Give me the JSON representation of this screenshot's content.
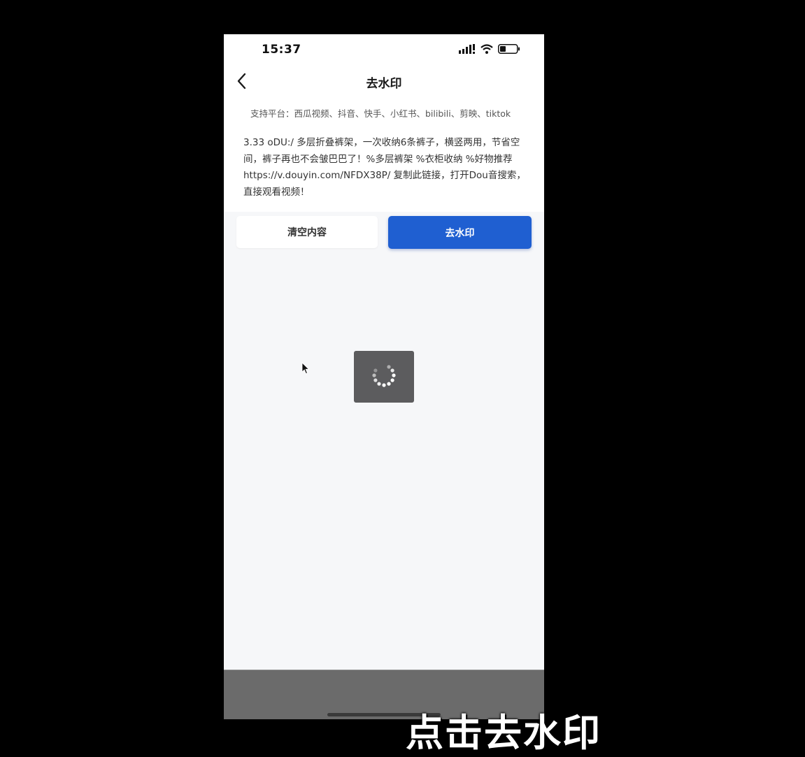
{
  "status_bar": {
    "time": "15:37"
  },
  "nav": {
    "title": "去水印"
  },
  "platforms_text": "支持平台：西瓜视频、抖音、快手、小红书、bilibili、剪映、tiktok",
  "input": {
    "value": "3.33 oDU:/ 多层折叠裤架，一次收纳6条裤子，横竖两用，节省空间，裤子再也不会皱巴巴了！%多层裤架 %衣柜收纳 %好物推荐  https://v.douyin.com/NFDX38P/ 复制此链接，打开Dou音搜索，直接观看视频！"
  },
  "buttons": {
    "clear_label": "清空内容",
    "remove_label": "去水印"
  },
  "caption": "点击去水印",
  "colors": {
    "primary": "#1f5fd1",
    "background": "#000000",
    "content_bg": "#f6f7f9",
    "loader_bg": "#5c5c5e"
  },
  "icons": {
    "back": "chevron-left-icon",
    "signal": "signal-icon",
    "wifi": "wifi-icon",
    "battery": "battery-icon",
    "spinner": "spinner-icon",
    "cursor": "mouse-cursor-icon"
  }
}
